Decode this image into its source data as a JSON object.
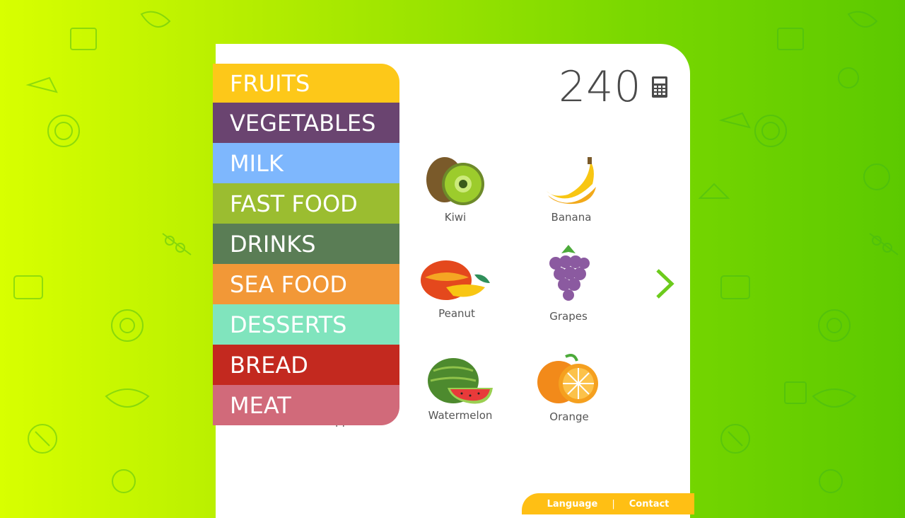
{
  "counter": {
    "value": "240",
    "icon": "calculator-icon"
  },
  "menu": {
    "items": [
      {
        "label": "FRUITS",
        "color": "#fdc819"
      },
      {
        "label": "VEGETABLES",
        "color": "#6a4470"
      },
      {
        "label": "MILK",
        "color": "#7eb7fd"
      },
      {
        "label": "FAST FOOD",
        "color": "#9bbd30"
      },
      {
        "label": "DRINKS",
        "color": "#5a7d55"
      },
      {
        "label": "SEA FOOD",
        "color": "#f29837"
      },
      {
        "label": "DESSERTS",
        "color": "#80e4bd"
      },
      {
        "label": "BREAD",
        "color": "#c3291f"
      },
      {
        "label": "MEAT",
        "color": "#d16a7a"
      }
    ]
  },
  "products": [
    {
      "label": "Kiwi",
      "icon": "kiwi-icon"
    },
    {
      "label": "Banana",
      "icon": "banana-icon"
    },
    {
      "label": "Peanut",
      "icon": "mango-icon"
    },
    {
      "label": "Grapes",
      "icon": "grapes-icon"
    },
    {
      "label": "Pineapple",
      "icon": "pineapple-icon"
    },
    {
      "label": "Watermelon",
      "icon": "watermelon-icon"
    },
    {
      "label": "Orange",
      "icon": "orange-icon"
    }
  ],
  "footer": {
    "language": "Language",
    "separator": "|",
    "contact": "Contact"
  }
}
